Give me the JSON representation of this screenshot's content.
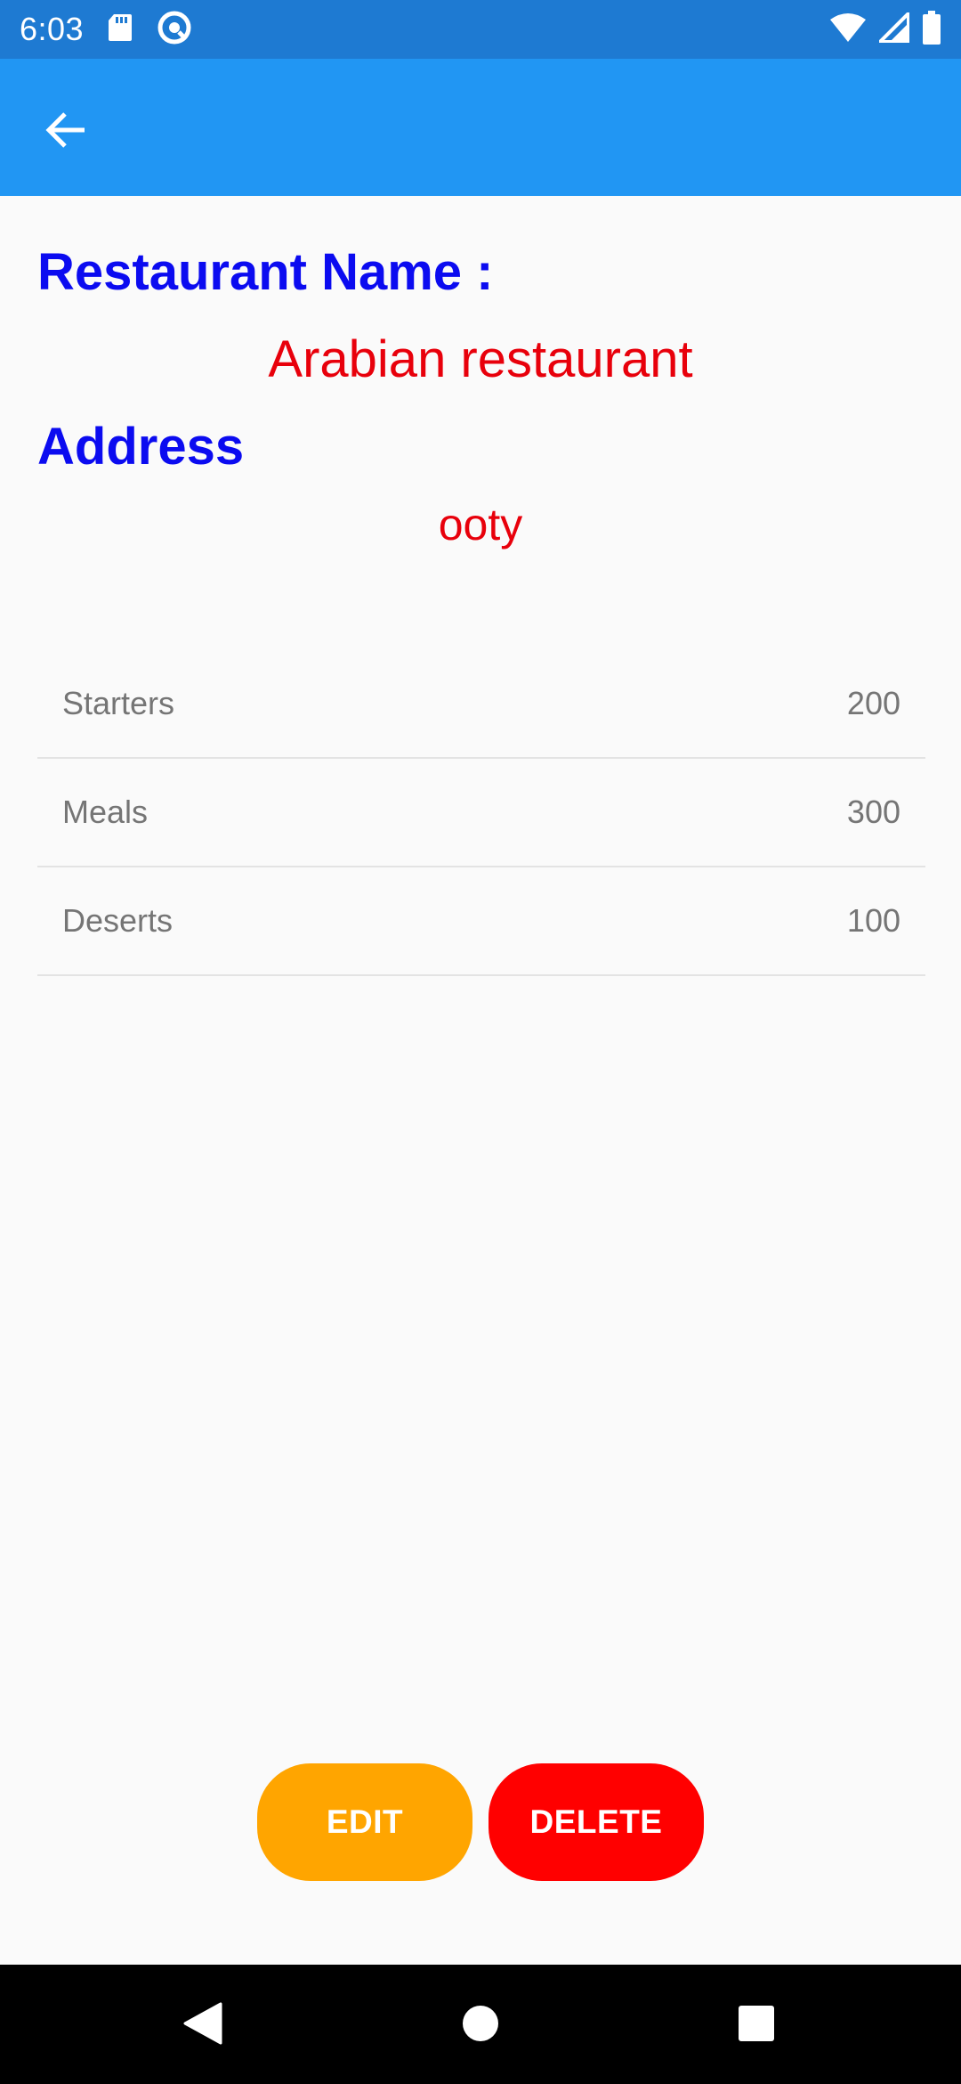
{
  "status_bar": {
    "time": "6:03",
    "left_icons": [
      "sd-card-icon",
      "sync-icon"
    ],
    "right_icons": [
      "wifi-icon",
      "signal-icon",
      "battery-icon"
    ]
  },
  "app_bar": {
    "back_icon": "arrow-back-icon",
    "color": "#2196f3"
  },
  "restaurant": {
    "name_label": "Restaurant Name :",
    "name_value": "Arabian restaurant",
    "address_label": "Address",
    "address_value": "ooty"
  },
  "menu": {
    "items": [
      {
        "name": "Starters",
        "price": "200"
      },
      {
        "name": "Meals",
        "price": "300"
      },
      {
        "name": "Deserts",
        "price": "100"
      }
    ]
  },
  "actions": {
    "edit_label": "EDIT",
    "delete_label": "DELETE",
    "edit_color": "#ffa500",
    "delete_color": "#ff0000"
  },
  "colors": {
    "label": "#0b0bf0",
    "value": "#e8000b",
    "status_bar": "#1e7ad2"
  },
  "nav_bar": {
    "icons": [
      "nav-back-icon",
      "nav-home-icon",
      "nav-recents-icon"
    ]
  }
}
